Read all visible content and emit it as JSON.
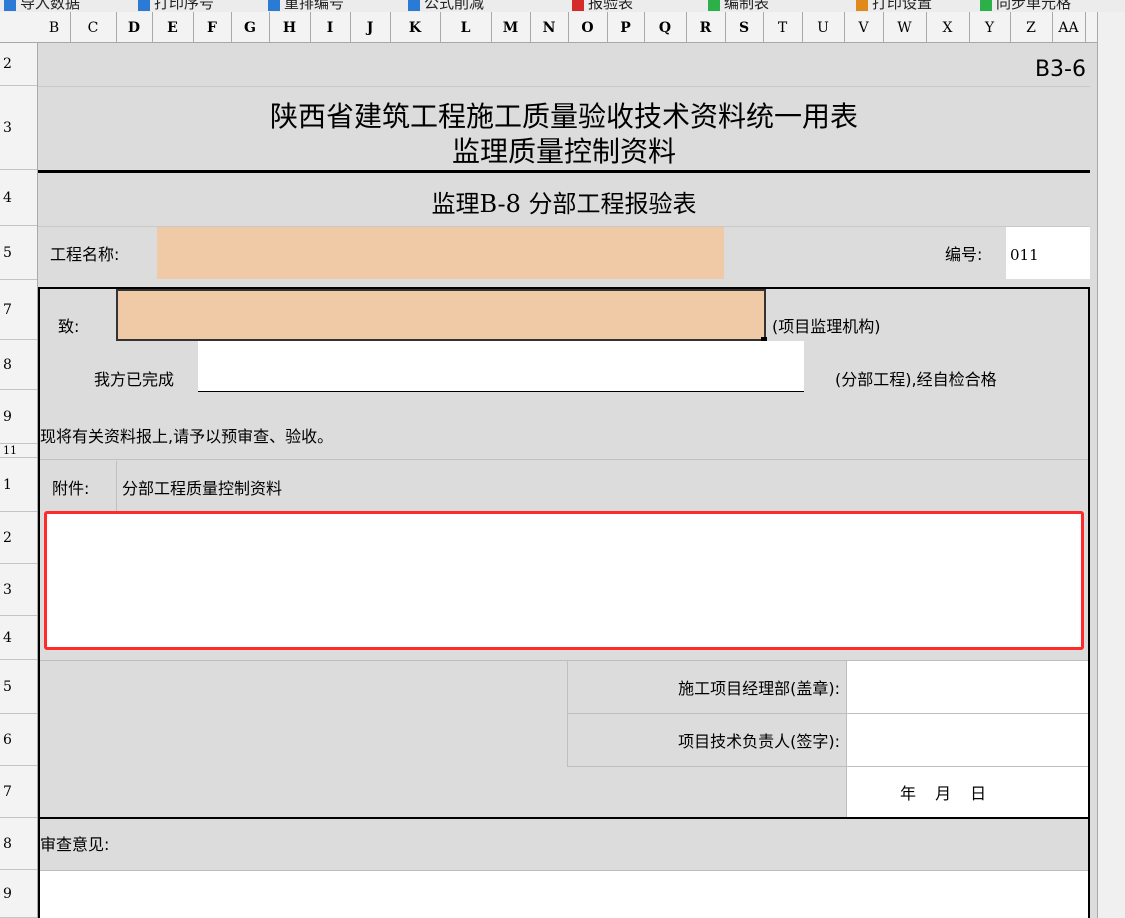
{
  "toolbar": {
    "items": [
      {
        "label": "导入数据",
        "icon": "import-icon",
        "color": "#2b7bd6"
      },
      {
        "label": "打印序号",
        "icon": "print-icon",
        "color": "#2b7bd6"
      },
      {
        "label": "重排编号",
        "icon": "renumber-icon",
        "color": "#2b7bd6"
      },
      {
        "label": "公式削减",
        "icon": "formula-icon",
        "color": "#2b7bd6"
      },
      {
        "label": "报验表",
        "icon": "report-icon",
        "color": "#d62b2b"
      },
      {
        "label": "编制表",
        "icon": "sheet-icon",
        "color": "#2bb04a"
      },
      {
        "label": "打印设置",
        "icon": "print-settings-icon",
        "color": "#e08a1c"
      },
      {
        "label": "同步单元格",
        "icon": "sync-icon",
        "color": "#2bb04a"
      }
    ]
  },
  "columns": [
    "B",
    "C",
    "D",
    "E",
    "F",
    "G",
    "H",
    "I",
    "J",
    "K",
    "L",
    "M",
    "N",
    "O",
    "P",
    "Q",
    "R",
    "S",
    "T",
    "U",
    "V",
    "W",
    "X",
    "Y",
    "Z",
    "AA"
  ],
  "rows": [
    "2",
    "3",
    "4",
    "5",
    "7",
    "8",
    "9",
    "11",
    "1",
    "2",
    "3",
    "4",
    "5",
    "6",
    "7",
    "8",
    "9"
  ],
  "form": {
    "code": "B3-6",
    "title_line1": "陕西省建筑工程施工质量验收技术资料统一用表",
    "title_line2": "监理质量控制资料",
    "subtitle": "监理B-8 分部工程报验表",
    "project_name_label": "工程名称:",
    "project_name_value": "",
    "number_label": "编号:",
    "number_value": "011",
    "to_label": "致:",
    "to_value": "",
    "to_suffix": "(项目监理机构)",
    "completed_label": "我方已完成",
    "completed_value": "",
    "completed_suffix": "(分部工程),经自检合格",
    "submit_text": "现将有关资料报上,请予以预审查、验收。",
    "attachment_label": "附件:",
    "attachment_value": "分部工程质量控制资料",
    "attachment_detail": "",
    "dept_label": "施工项目经理部(盖章):",
    "tech_label": "项目技术负责人(签字):",
    "date_label": "年 月 日",
    "review_label": "审查意见:"
  },
  "colors": {
    "highlight_border": "#ff2a2a",
    "peach": "#f0c9a6",
    "gray": "#dcdcdc"
  }
}
